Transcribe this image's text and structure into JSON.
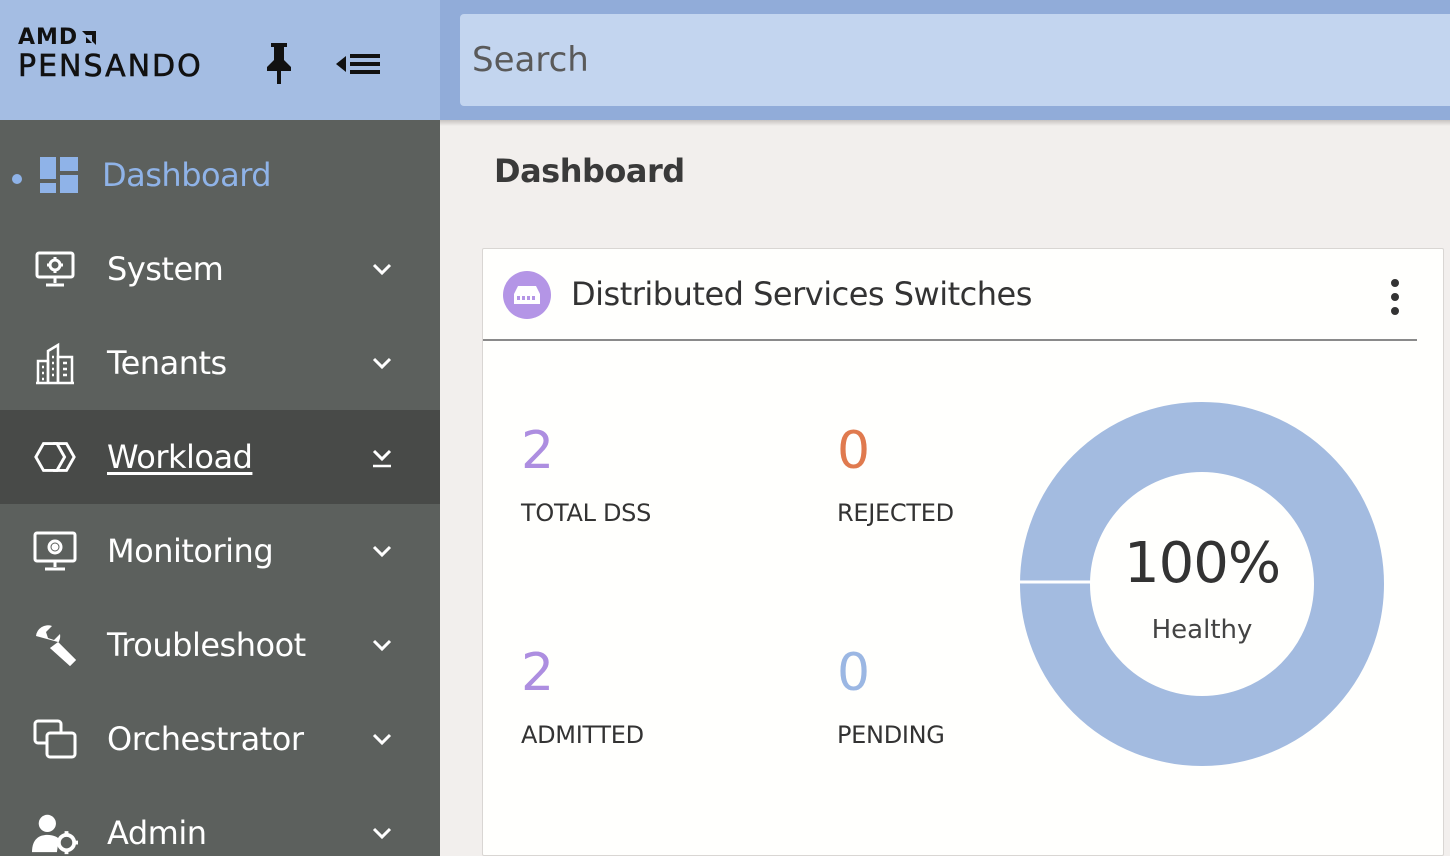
{
  "brand": {
    "company": "AMD",
    "product": "PENSANDO"
  },
  "search": {
    "placeholder": "Search"
  },
  "nav": [
    {
      "label": "Dashboard",
      "icon": "dashboard-icon",
      "selected": true
    },
    {
      "label": "System",
      "icon": "monitor-gear-icon"
    },
    {
      "label": "Tenants",
      "icon": "building-icon"
    },
    {
      "label": "Workload",
      "icon": "hexagons-icon",
      "active": true
    },
    {
      "label": "Monitoring",
      "icon": "monitor-gear-icon"
    },
    {
      "label": "Troubleshoot",
      "icon": "wrench-icon"
    },
    {
      "label": "Orchestrator",
      "icon": "windows-icon"
    },
    {
      "label": "Admin",
      "icon": "user-gear-icon"
    }
  ],
  "page": {
    "title": "Dashboard"
  },
  "card": {
    "title": "Distributed Services Switches",
    "icon": "switch-icon",
    "stats": {
      "total": {
        "value": "2",
        "label": "TOTAL DSS"
      },
      "rejected": {
        "value": "0",
        "label": "REJECTED"
      },
      "admitted": {
        "value": "2",
        "label": "ADMITTED"
      },
      "pending": {
        "value": "0",
        "label": "PENDING"
      }
    },
    "health": {
      "percent_text": "100%",
      "percent": 100,
      "label": "Healthy"
    }
  },
  "colors": {
    "sidebar": "#5c605d",
    "brand_bg": "#a4bde3",
    "accent_blue": "#9bb7e3",
    "accent_purple": "#ad8ee0",
    "accent_orange": "#e07a4e"
  }
}
